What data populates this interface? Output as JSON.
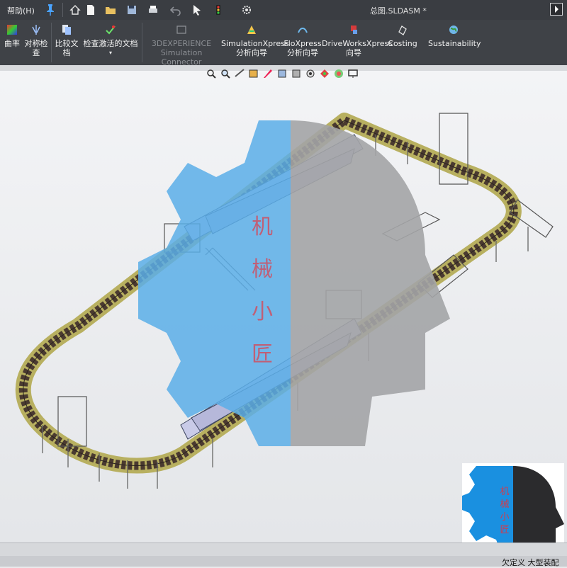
{
  "menu": {
    "help": "帮助(H)"
  },
  "document": {
    "title": "总图.SLDASM *"
  },
  "quick_access_icons": [
    "home-icon",
    "new-file-icon",
    "open-folder-icon",
    "save-icon",
    "print-icon",
    "undo-icon",
    "select-cursor-icon",
    "rebuild-traffic-light-icon",
    "options-gear-icon"
  ],
  "ribbon": {
    "curvature": {
      "line1": "曲率",
      "line2": ""
    },
    "symmetry_check": {
      "line1": "对称检",
      "line2": "查"
    },
    "compare_docs": {
      "line1": "比较文",
      "line2": "档"
    },
    "check_active_doc": {
      "line1": "检查激活的文档",
      "line2": ""
    },
    "experience": {
      "line1": "3DEXPERIENCE",
      "line2": "Simulation Connector"
    },
    "simulationxpress": {
      "line1": "SimulationXpress",
      "line2": "分析向导"
    },
    "floxpress": {
      "line1": "FloXpress",
      "line2": "分析向导"
    },
    "driveworksxpress": {
      "line1": "DriveWorksXpress",
      "line2": "向导"
    },
    "costing": {
      "line1": "",
      "line2": "Costing"
    },
    "sustainability": {
      "line1": "Sustainability",
      "line2": ""
    }
  },
  "view_toolbar_icons": [
    "zoom-to-fit-icon",
    "zoom-area-icon",
    "previous-view-icon",
    "section-view-icon",
    "dynamic-annotation-icon",
    "view-orientation-icon",
    "display-style-icon",
    "hide-show-icon",
    "edit-appearance-icon",
    "apply-scene-icon",
    "view-settings-icon"
  ],
  "watermark": {
    "text": [
      "机",
      "械",
      "小",
      "匠"
    ]
  },
  "status": {
    "text": "欠定义  大型装配"
  },
  "colors": {
    "ribbon_bg": "#3f4247",
    "titlebar_bg": "#3a3d42",
    "viewport_bg": "#eceef0",
    "watermark_blue": "#5aaee8",
    "watermark_gray": "#a3a4a6",
    "watermark_red": "#d44a5a",
    "conveyor_track": "#4a3a30",
    "conveyor_edge": "#b8b060"
  }
}
